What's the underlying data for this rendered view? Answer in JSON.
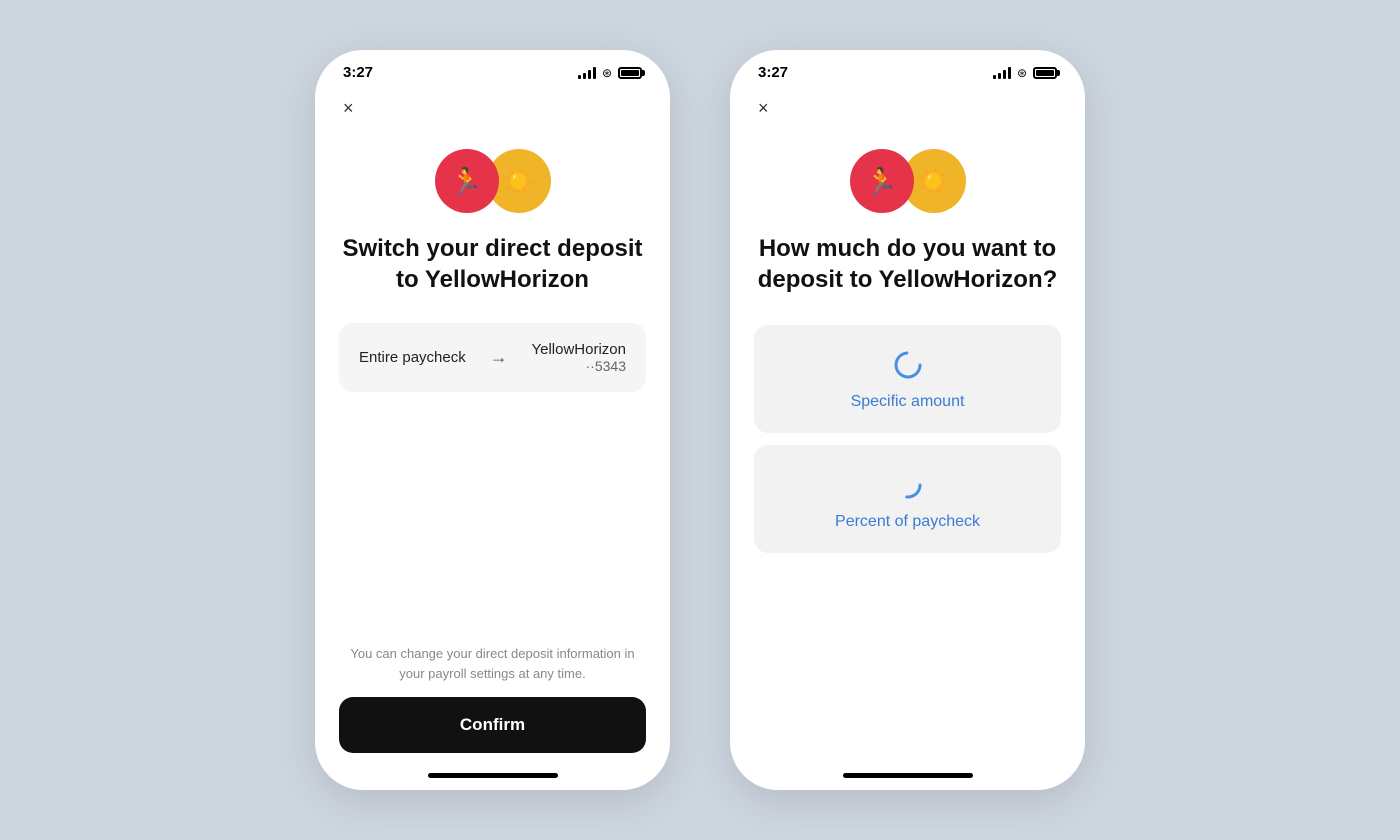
{
  "background_color": "#cdd5df",
  "phone1": {
    "status_bar": {
      "time": "3:27",
      "signal_label": "signal",
      "wifi_label": "wifi",
      "battery_label": "battery"
    },
    "close_button_label": "×",
    "icon_red_symbol": "🏃",
    "icon_yellow_symbol": "☀",
    "title": "Switch your direct deposit to YellowHorizon",
    "deposit_card": {
      "from_label": "Entire paycheck",
      "arrow": "→",
      "to_name": "YellowHorizon",
      "to_account": "··5343"
    },
    "footer_note": "You can change your direct deposit information in your payroll settings at any time.",
    "confirm_button": "Confirm",
    "home_indicator": true
  },
  "phone2": {
    "status_bar": {
      "time": "3:27",
      "signal_label": "signal",
      "wifi_label": "wifi",
      "battery_label": "battery"
    },
    "close_button_label": "×",
    "icon_red_symbol": "🏃",
    "icon_yellow_symbol": "☀",
    "title": "How much do you want to deposit to YellowHorizon?",
    "options": [
      {
        "id": "specific-amount",
        "label": "Specific amount",
        "icon": "circle-partial"
      },
      {
        "id": "percent-paycheck",
        "label": "Percent of paycheck",
        "icon": "circle-partial-2"
      }
    ],
    "home_indicator": true
  }
}
